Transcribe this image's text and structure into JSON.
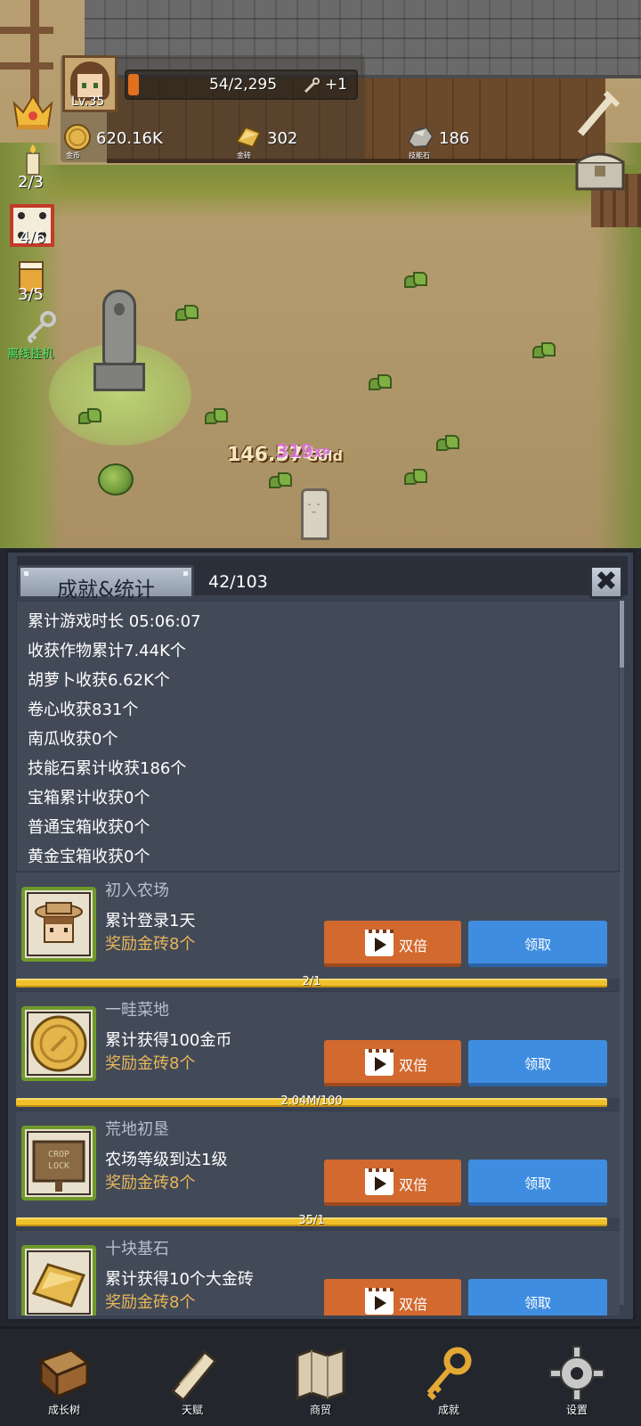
{
  "hud": {
    "level": "Lv.35",
    "xp_text": "54/2,295",
    "xp_fraction": 0.024,
    "xp_bonus": "+1",
    "resources": [
      {
        "value": "620.16K",
        "label": "金币",
        "icon": "gold-coin-icon"
      },
      {
        "value": "302",
        "label": "金砖",
        "icon": "gold-brick-icon"
      },
      {
        "value": "186",
        "label": "技能石",
        "icon": "skill-stone-icon"
      }
    ]
  },
  "side": {
    "candle_count": "2/3",
    "dice_count": "4/6",
    "beer_count": "3/5",
    "idle_label": "离线挂机"
  },
  "scene": {
    "float_gold_value": "146.57",
    "float_gold_unit": "Gold",
    "float_exp_value": "319",
    "float_exp_unit": "XP"
  },
  "panel": {
    "title": "成就&统计",
    "progress": "42/103",
    "close": "✖",
    "stats": [
      "累计游戏时长 05:06:07",
      "收获作物累计7.44K个",
      "胡萝卜收获6.62K个",
      "卷心收获831个",
      "南瓜收获0个",
      "技能石累计收获186个",
      "宝箱累计收获0个",
      "普通宝箱收获0个",
      "黄金宝箱收获0个"
    ],
    "double_label": "双倍",
    "claim_label": "领取",
    "achievements": [
      {
        "name": "初入农场",
        "desc": "累计登录1天",
        "reward": "奖励金砖8个",
        "progress": "2/1",
        "icon": "farmer-portrait-icon"
      },
      {
        "name": "一畦菜地",
        "desc": "累计获得100金币",
        "reward": "奖励金砖8个",
        "progress": "2.04M/100",
        "icon": "gold-coin-icon"
      },
      {
        "name": "荒地初垦",
        "desc": "农场等级到达1级",
        "reward": "奖励金砖8个",
        "progress": "35/1",
        "icon": "crop-lock-sign-icon"
      },
      {
        "name": "十块基石",
        "desc": "累计获得10个大金砖",
        "reward": "奖励金砖8个",
        "progress": "",
        "icon": "gold-brick-icon"
      }
    ],
    "sign_text": "CROP LOCK"
  },
  "nav": [
    {
      "label": "成长树",
      "icon": "book-icon"
    },
    {
      "label": "天赋",
      "icon": "scroll-icon"
    },
    {
      "label": "商贸",
      "icon": "map-icon"
    },
    {
      "label": "成就",
      "icon": "key-icon"
    },
    {
      "label": "设置",
      "icon": "gear-icon"
    }
  ],
  "colors": {
    "double_button": "#d2692f",
    "claim_button": "#3f8de0",
    "reward_text": "#e8b659",
    "progress_bar": "#f0c02b"
  }
}
